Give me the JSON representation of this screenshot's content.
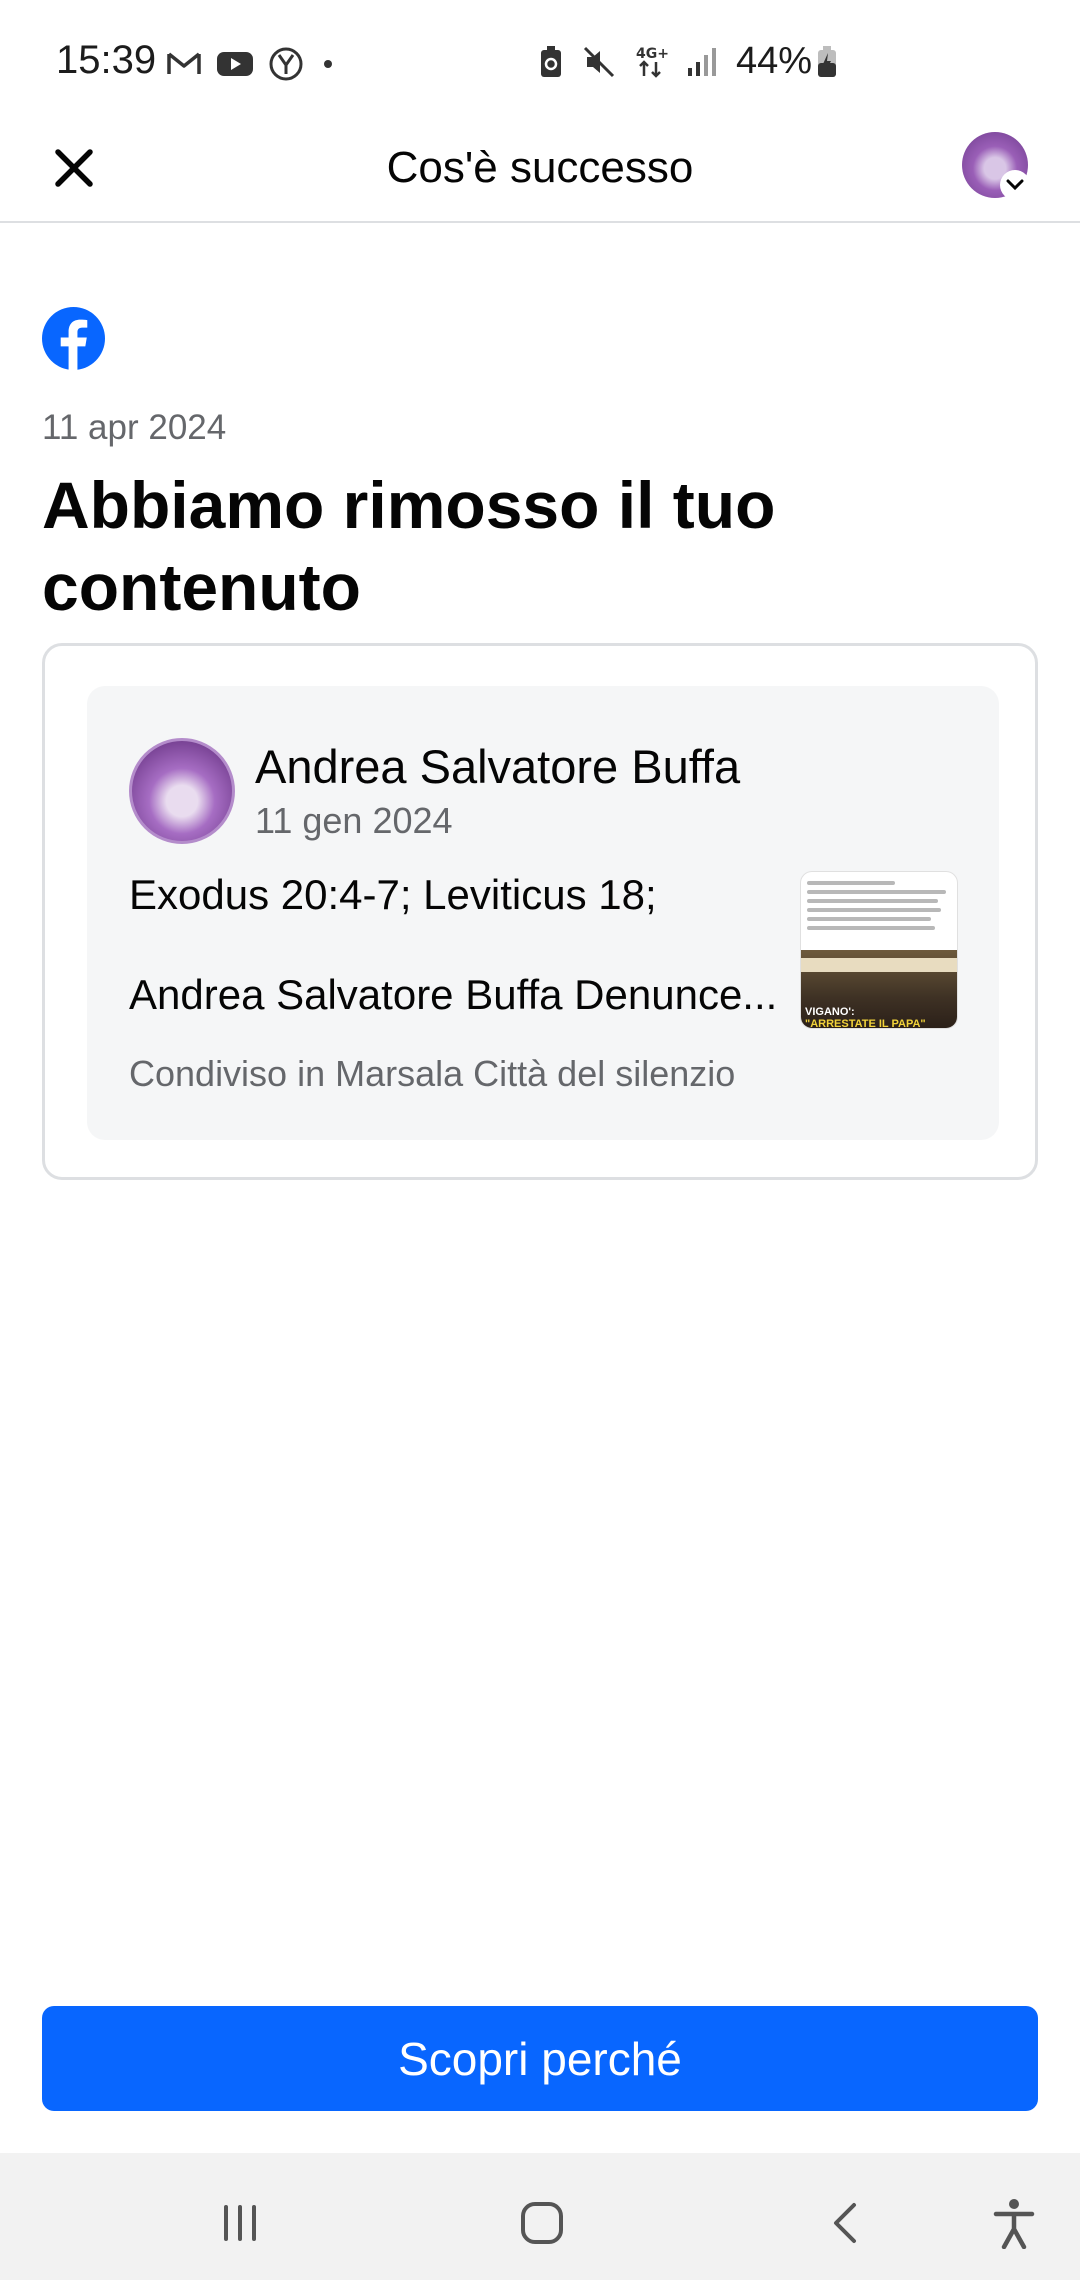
{
  "status_bar": {
    "time": "15:39",
    "battery_percent": "44%",
    "icons": [
      "gmail-icon",
      "youtube-icon",
      "yandex-icon",
      "dot-icon",
      "battery-saver-icon",
      "mute-icon",
      "4g-icon",
      "signal-icon",
      "battery-icon"
    ]
  },
  "header": {
    "title": "Cos'è successo",
    "close_icon": "close-icon",
    "avatar_icon": "profile-avatar"
  },
  "notice": {
    "platform_icon": "facebook-icon",
    "brand_color": "#0866FF",
    "date": "11 apr 2024",
    "title": "Abbiamo rimosso il tuo contenuto"
  },
  "post": {
    "author": "Andrea Salvatore Buffa",
    "date": "11 gen 2024",
    "line1": "Exodus 20:4-7; Leviticus 18;",
    "line2": "Andrea Salvatore Buffa Denunce...",
    "shared_in": "Condiviso in Marsala Città del silenzio",
    "thumbnail_caption": "VIGANO':",
    "thumbnail_caption2": "\"ARRESTATE IL PAPA\""
  },
  "actions": {
    "primary_label": "Scopri perché"
  },
  "nav_bar": {
    "icons": [
      "recent-apps-icon",
      "home-icon",
      "back-icon",
      "accessibility-icon"
    ]
  }
}
